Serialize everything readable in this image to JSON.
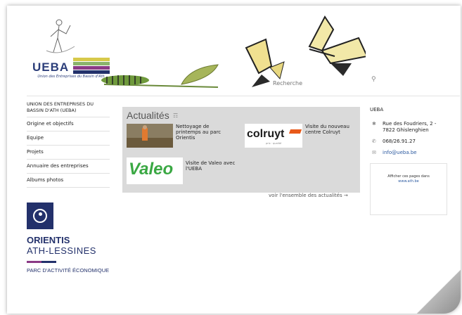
{
  "header": {
    "logo_text": "UEBA",
    "logo_subtitle": "Union des Entreprises du Bassin d'Ath",
    "search_placeholder": "Recherche"
  },
  "sidebar": {
    "title": "UNION DES ENTREPRISES DU BASSIN D'ATH (UEBA)",
    "items": [
      {
        "label": "Origine et objectifs"
      },
      {
        "label": "Equipe"
      },
      {
        "label": "Projets"
      },
      {
        "label": "Annuaire des entreprises"
      },
      {
        "label": "Albums photos"
      }
    ]
  },
  "partner": {
    "name": "ORIENTIS",
    "name2": "ATH-LESSINES",
    "tagline": "PARC D'ACTIVITÉ ÉCONOMIQUE"
  },
  "news": {
    "title": "Actualités",
    "items": [
      {
        "text": "Nettoyage de printemps au parc Orientis"
      },
      {
        "text": "Visite du nouveau centre Colruyt",
        "logo": "colruyt",
        "slogan": "prix · qualité"
      },
      {
        "text": "Visite de Valeo avec l'UEBA",
        "logo": "Valeo"
      }
    ],
    "more_link": "voir l'ensemble des actualités →"
  },
  "contact": {
    "title": "UEBA",
    "address": "Rue des Foudriers, 2 - 7822 Ghislenghien",
    "phone": "068/26.91.27",
    "email": "info@ueba.be"
  },
  "widget": {
    "text": "Afficher ces pages dans",
    "link": "www.ath.be"
  },
  "colors": {
    "brand_navy": "#23316b",
    "news_bg": "#dadada",
    "valeo_green": "#3aa843",
    "link_blue": "#2c5aa0"
  }
}
